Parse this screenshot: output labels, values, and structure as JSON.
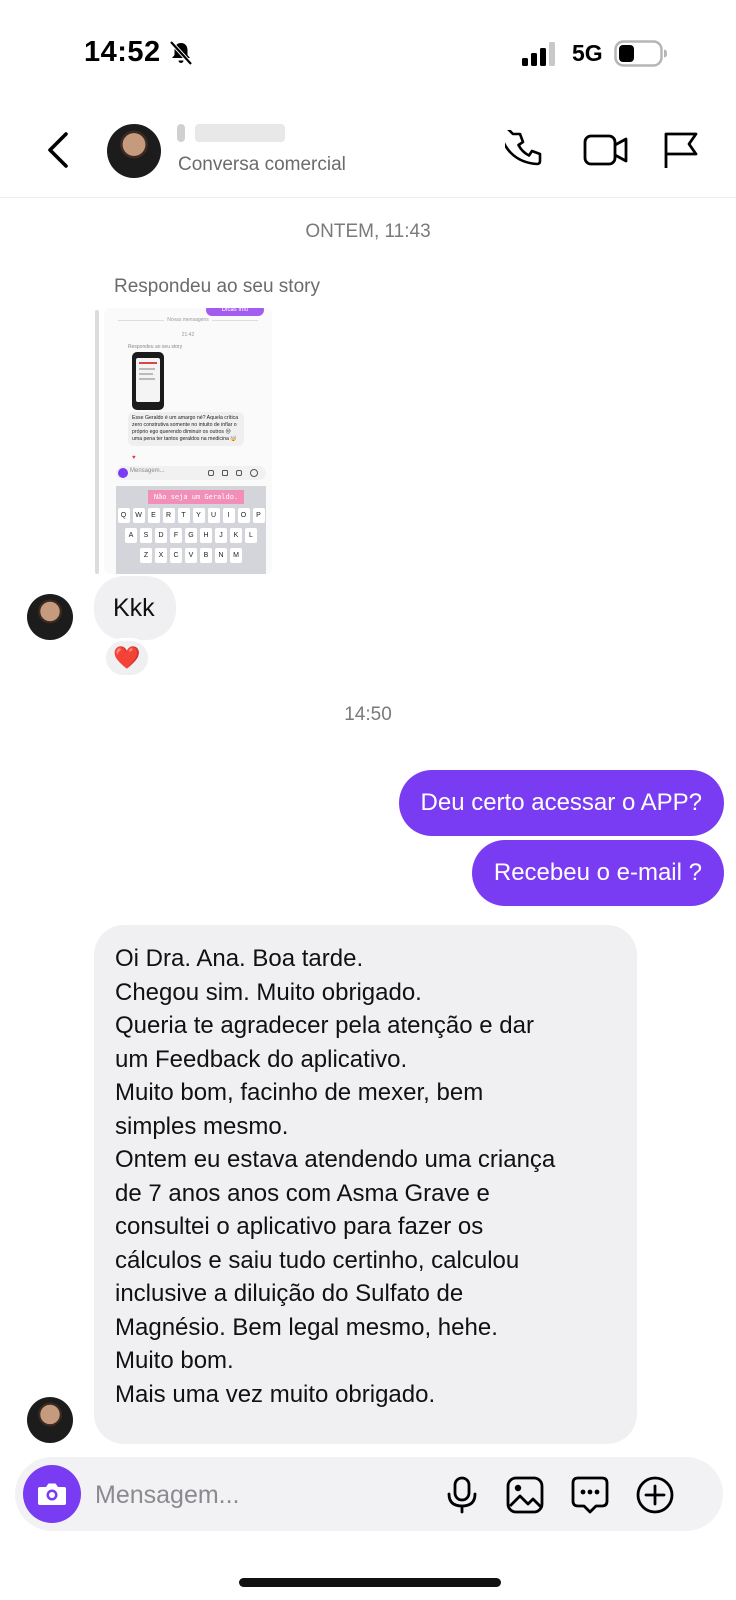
{
  "status_bar": {
    "time": "14:52",
    "network": "5G"
  },
  "header": {
    "subtitle": "Conversa comercial"
  },
  "chat": {
    "timestamp_1": "ONTEM, 11:43",
    "story_reply_label": "Respondeu ao seu story",
    "story_preview": {
      "top_chip": "Dicas Info",
      "new_messages": "Novas mensagens",
      "time": "21:42",
      "replied_label": "Respondeu ao seu story",
      "message": "Esse Geraldo é um amargo né? Aquela crítica zero construtiva somente no intuito de inflar o próprio ego querendo diminuir os outros 😒 uma pena ter tantos geraldos na medicina 🤯",
      "composer_placeholder": "Mensagem...",
      "typed_text": "Não seja um Geraldo.",
      "keyboard_rows": [
        [
          "Q",
          "W",
          "E",
          "R",
          "T",
          "Y",
          "U",
          "I",
          "O",
          "P"
        ],
        [
          "A",
          "S",
          "D",
          "F",
          "G",
          "H",
          "J",
          "K",
          "L"
        ],
        [
          "Z",
          "X",
          "C",
          "V",
          "B",
          "N",
          "M"
        ]
      ]
    },
    "msg_kkk": "Kkk",
    "reaction": "❤️",
    "timestamp_2": "14:50",
    "sent": [
      "Deu certo acessar o APP?",
      "Recebeu o e-mail ?"
    ],
    "received_lines": [
      "Oi Dra. Ana. Boa tarde.",
      "Chegou sim. Muito obrigado.",
      "Queria te agradecer pela atenção e  dar",
      "um Feedback do aplicativo.",
      "Muito bom, facinho de mexer, bem",
      "simples mesmo.",
      "Ontem eu estava atendendo uma criança",
      "de 7 anos anos com Asma Grave e",
      "consultei o aplicativo para fazer os",
      "cálculos e saiu tudo certinho, calculou",
      "inclusive a diluição do Sulfato de",
      "Magnésio. Bem legal mesmo, hehe.",
      "Muito bom.",
      "Mais uma vez muito obrigado."
    ]
  },
  "composer": {
    "placeholder": "Mensagem..."
  },
  "colors": {
    "accent": "#7a3cf2",
    "incoming_bubble": "#f0f0f2",
    "secondary_text": "#6b6b6b"
  }
}
